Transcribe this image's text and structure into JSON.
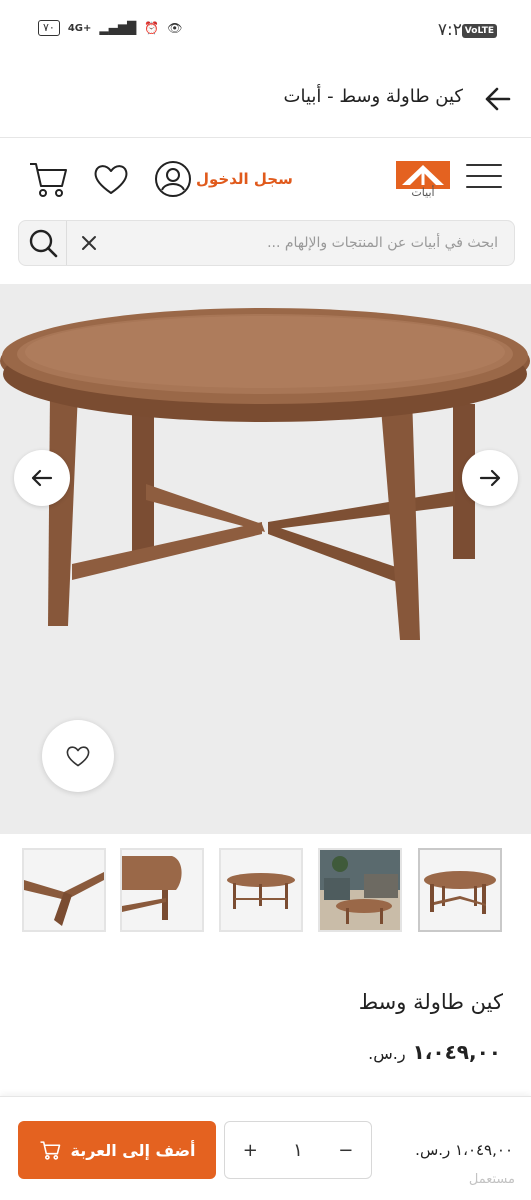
{
  "status_bar": {
    "time": "٧:٢٥",
    "network_badge": "VoLTE",
    "battery": "٧٠",
    "signal": "4G+"
  },
  "app_bar": {
    "title": "كين طاولة وسط - أبيات"
  },
  "header": {
    "logo_text": "أبيات",
    "login_label": "سجل الدخول"
  },
  "search": {
    "placeholder": "ابحث في أبيات عن المنتجات والإلهام ..."
  },
  "product": {
    "name": "كين طاولة وسط",
    "price": "١،٠٤٩,٠٠",
    "currency": "ر.س."
  },
  "cart_bar": {
    "add_label": "أضف إلى العربة",
    "quantity": "١",
    "plus": "+",
    "minus": "−",
    "price": "١،٠٤٩,٠٠",
    "currency": "ر.س."
  },
  "watermark": "مستعمل",
  "colors": {
    "accent": "#e46220",
    "login": "#e05a1c",
    "wood": "#8a5a3c"
  }
}
